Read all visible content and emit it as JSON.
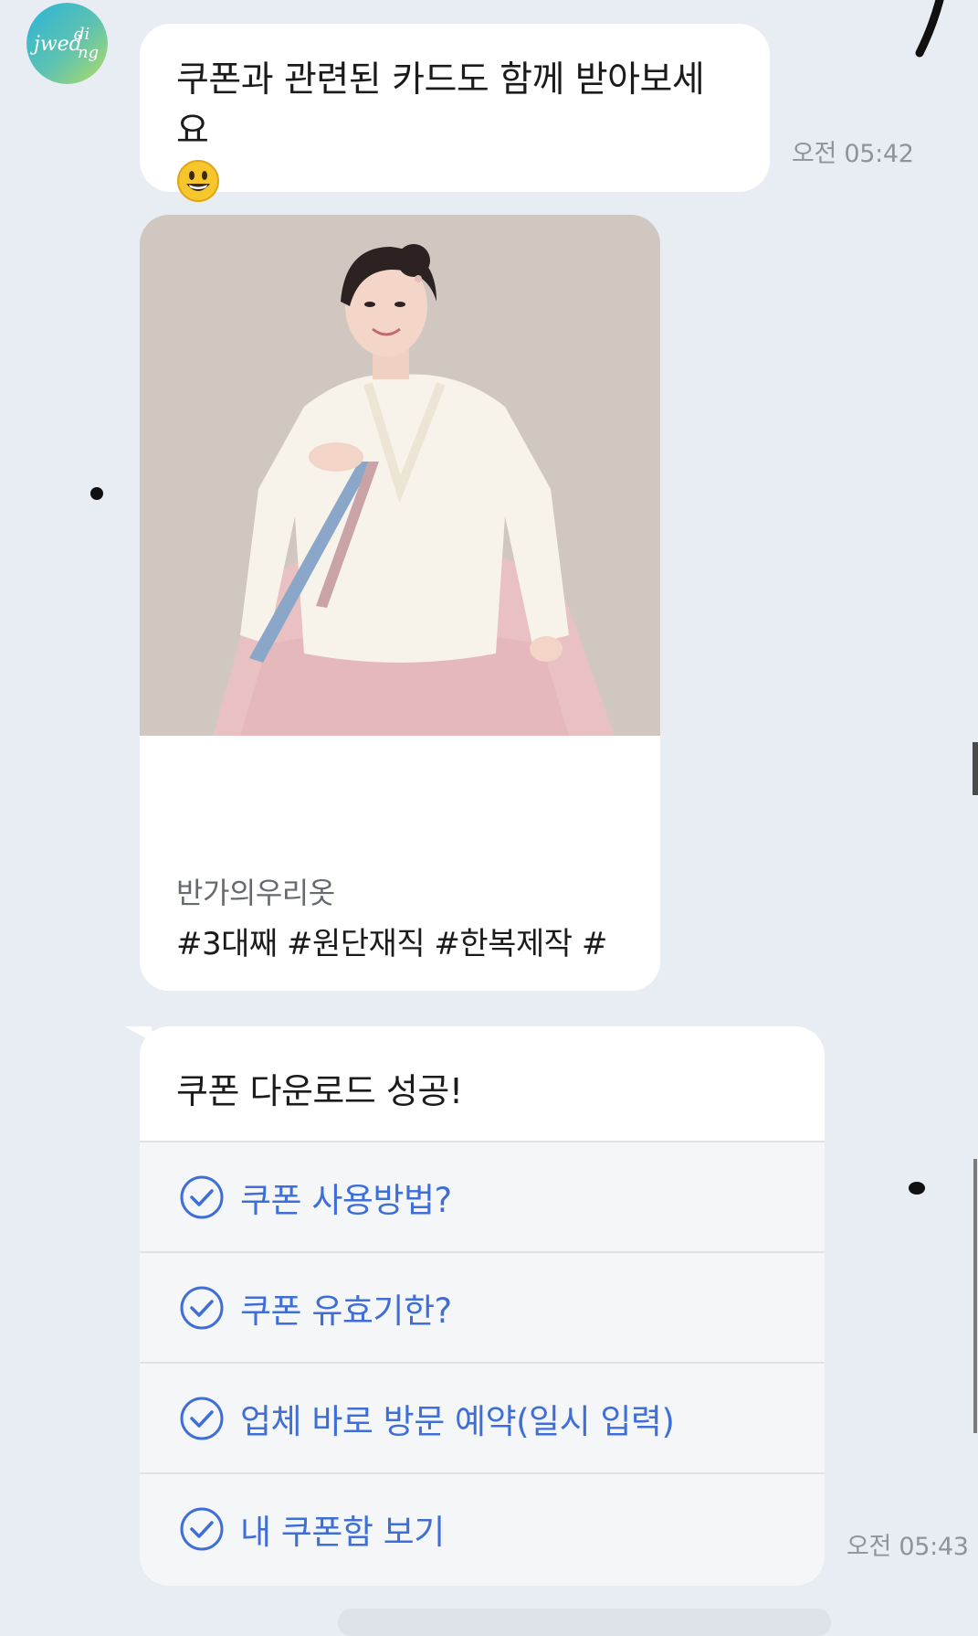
{
  "chat": {
    "avatar": {
      "label": "jwedding",
      "icon": "jwedding-logo-avatar",
      "gradient": [
        "#2bb3d8",
        "#6cc7a0",
        "#a9d76a"
      ]
    },
    "message_1": {
      "text": "쿠폰과 관련된 카드도 함께 받아보세요",
      "emoji": "grinning-face-emoji",
      "time": "오전 05:42"
    },
    "product_card": {
      "image": "model-in-white-and-pink-hanbok",
      "vendor": "반가의우리옷",
      "tags": "#3대째 #원단재직 #한복제작 #"
    },
    "coupon_card": {
      "title": "쿠폰 다운로드 성공!",
      "items": [
        {
          "label": "쿠폰 사용방법?",
          "icon": "check-circle-icon"
        },
        {
          "label": "쿠폰 유효기한?",
          "icon": "check-circle-icon"
        },
        {
          "label": "업체 바로 방문 예약(일시 입력)",
          "icon": "check-circle-icon"
        },
        {
          "label": "내 쿠폰함 보기",
          "icon": "check-circle-icon"
        }
      ],
      "time": "오전 05:43"
    }
  },
  "colors": {
    "background": "#e8ecf3",
    "bubble": "#ffffff",
    "link_blue": "#3f6fd6",
    "time_gray": "#8f949c"
  }
}
